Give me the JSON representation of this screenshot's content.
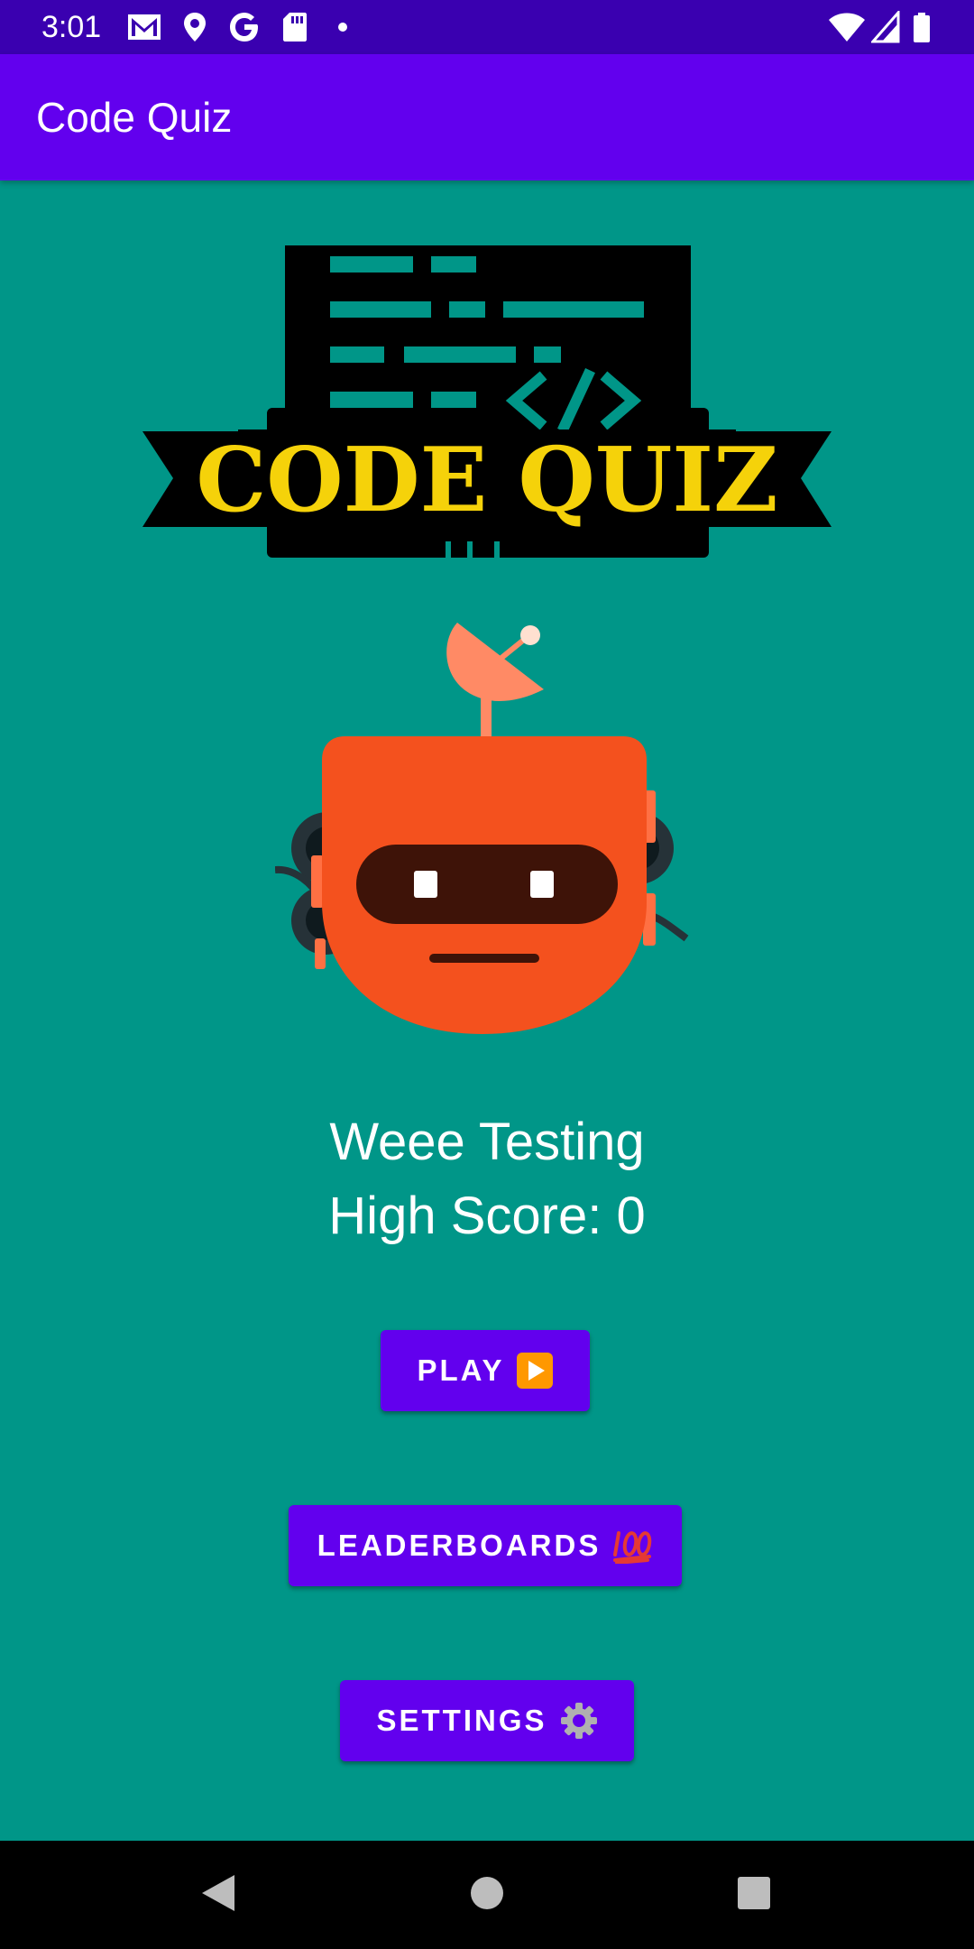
{
  "status_bar": {
    "time": "3:01",
    "left_icons": [
      "gmail-icon",
      "location-pin-icon",
      "google-g-icon",
      "sd-card-icon",
      "dot-icon"
    ],
    "right_icons": [
      "wifi-icon",
      "cellular-signal-icon",
      "battery-icon"
    ]
  },
  "app_bar": {
    "title": "Code Quiz"
  },
  "logo": {
    "text": "CODE QUIZ",
    "colors": {
      "box": "#000000",
      "lines": "#009688",
      "text": "#f5d20a"
    }
  },
  "user": {
    "name": "Weee Testing",
    "high_score_text": "High Score: 0"
  },
  "buttons": {
    "play": "PLAY",
    "leaderboards": "LEADERBOARDS",
    "settings": "SETTINGS"
  },
  "nav_bar": {
    "icons": [
      "back-icon",
      "home-icon",
      "recents-icon"
    ]
  },
  "colors": {
    "background": "#009688",
    "status_bar": "#3a00b0",
    "app_bar": "#6200ee",
    "button": "#6200ee",
    "robot": "#f4511e"
  }
}
